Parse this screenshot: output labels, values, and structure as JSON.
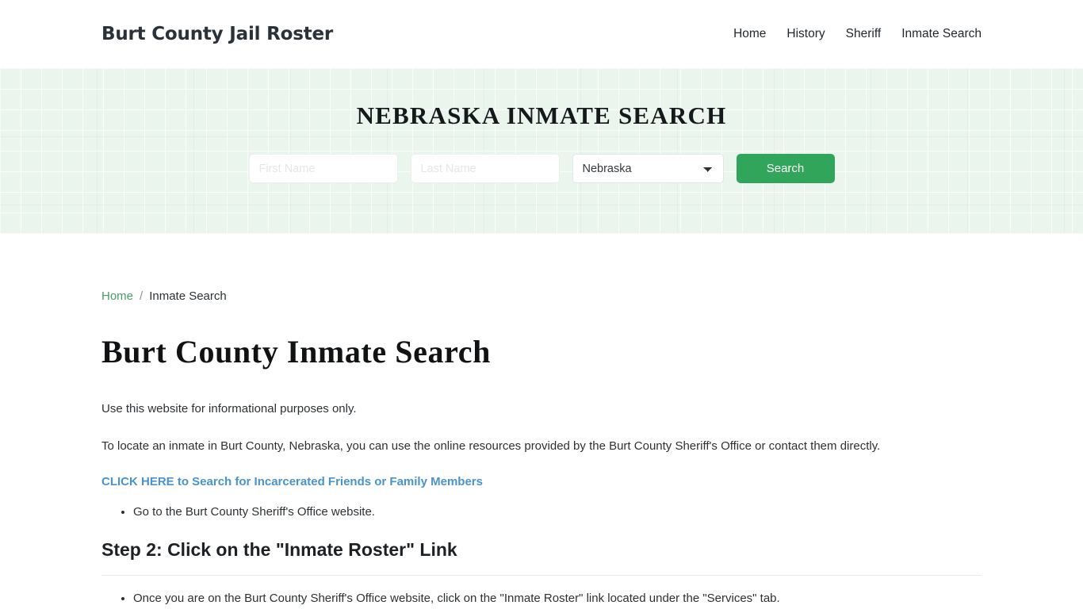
{
  "header": {
    "brand": "Burt County Jail Roster",
    "nav": [
      {
        "label": "Home"
      },
      {
        "label": "History"
      },
      {
        "label": "Sheriff"
      },
      {
        "label": "Inmate Search"
      }
    ]
  },
  "hero": {
    "title": "NEBRASKA INMATE SEARCH",
    "form": {
      "first_name_placeholder": "First Name",
      "first_name_value": "",
      "last_name_placeholder": "Last Name",
      "last_name_value": "",
      "state_selected": "Nebraska",
      "state_options": [
        "Nebraska"
      ],
      "search_label": "Search"
    },
    "background_color": "#e9f5ed",
    "button_color": "#31a65b"
  },
  "breadcrumb": {
    "home": "Home",
    "separator": "/",
    "current": "Inmate Search",
    "link_color": "#4a9c67"
  },
  "main": {
    "page_title": "Burt County Inmate Search",
    "intro": "Use this website for informational purposes only.",
    "paragraph": "To locate an inmate in Burt County, Nebraska, you can use the online resources provided by the Burt County Sheriff's Office or contact them directly.",
    "callout_link": "CLICK HERE to Search for Incarcerated Friends or Family Members",
    "callout_link_color": "#4a93cc",
    "step1_bullets": [
      "Go to the Burt County Sheriff's Office website."
    ],
    "step2_heading": "Step 2: Click on the \"Inmate Roster\" Link",
    "step2_bullets": [
      "Once you are on the Burt County Sheriff's Office website, click on the \"Inmate Roster\" link located under the \"Services\" tab."
    ]
  }
}
